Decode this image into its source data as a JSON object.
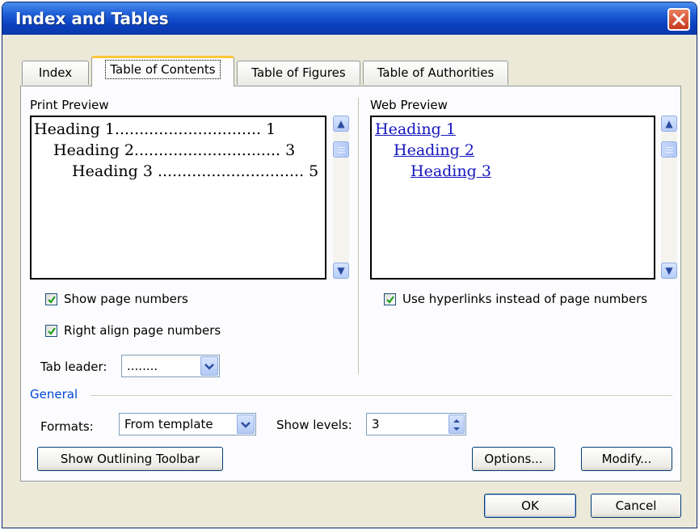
{
  "window": {
    "title": "Index and Tables"
  },
  "tabs": [
    {
      "label": "Index"
    },
    {
      "label": "Table of Contents",
      "active": true
    },
    {
      "label": "Table of Figures"
    },
    {
      "label": "Table of Authorities"
    }
  ],
  "print_preview": {
    "label": "Print Preview",
    "lines": [
      {
        "text": "Heading 1.............................. 1"
      },
      {
        "text": "Heading 2.............................. 3"
      },
      {
        "text": "Heading 3 .............................. 5"
      }
    ]
  },
  "web_preview": {
    "label": "Web Preview",
    "links": [
      "Heading 1",
      "Heading 2",
      "Heading 3"
    ]
  },
  "options": {
    "show_page_numbers": {
      "label": "Show page numbers",
      "checked": true
    },
    "right_align": {
      "label": "Right align page numbers",
      "checked": true
    },
    "use_hyperlinks": {
      "label": "Use hyperlinks instead of page numbers",
      "checked": true
    },
    "tab_leader": {
      "label": "Tab leader:",
      "value": "........"
    }
  },
  "general": {
    "label": "General",
    "formats": {
      "label": "Formats:",
      "value": "From template"
    },
    "show_levels": {
      "label": "Show levels:",
      "value": "3"
    }
  },
  "buttons": {
    "outlining": "Show Outlining Toolbar",
    "options": "Options...",
    "modify": "Modify...",
    "ok": "OK",
    "cancel": "Cancel"
  },
  "colors": {
    "titlebar": "#0a3fbf",
    "dialog_bg": "#ece9d8",
    "tab_highlight": "#ffc83c",
    "hyperlink": "#1515c0",
    "group_label": "#0046d5"
  },
  "icons": [
    "close-icon",
    "scroll-up-icon",
    "scroll-down-icon",
    "checkmark-icon",
    "chevron-down-icon",
    "spin-up-icon",
    "spin-down-icon"
  ]
}
